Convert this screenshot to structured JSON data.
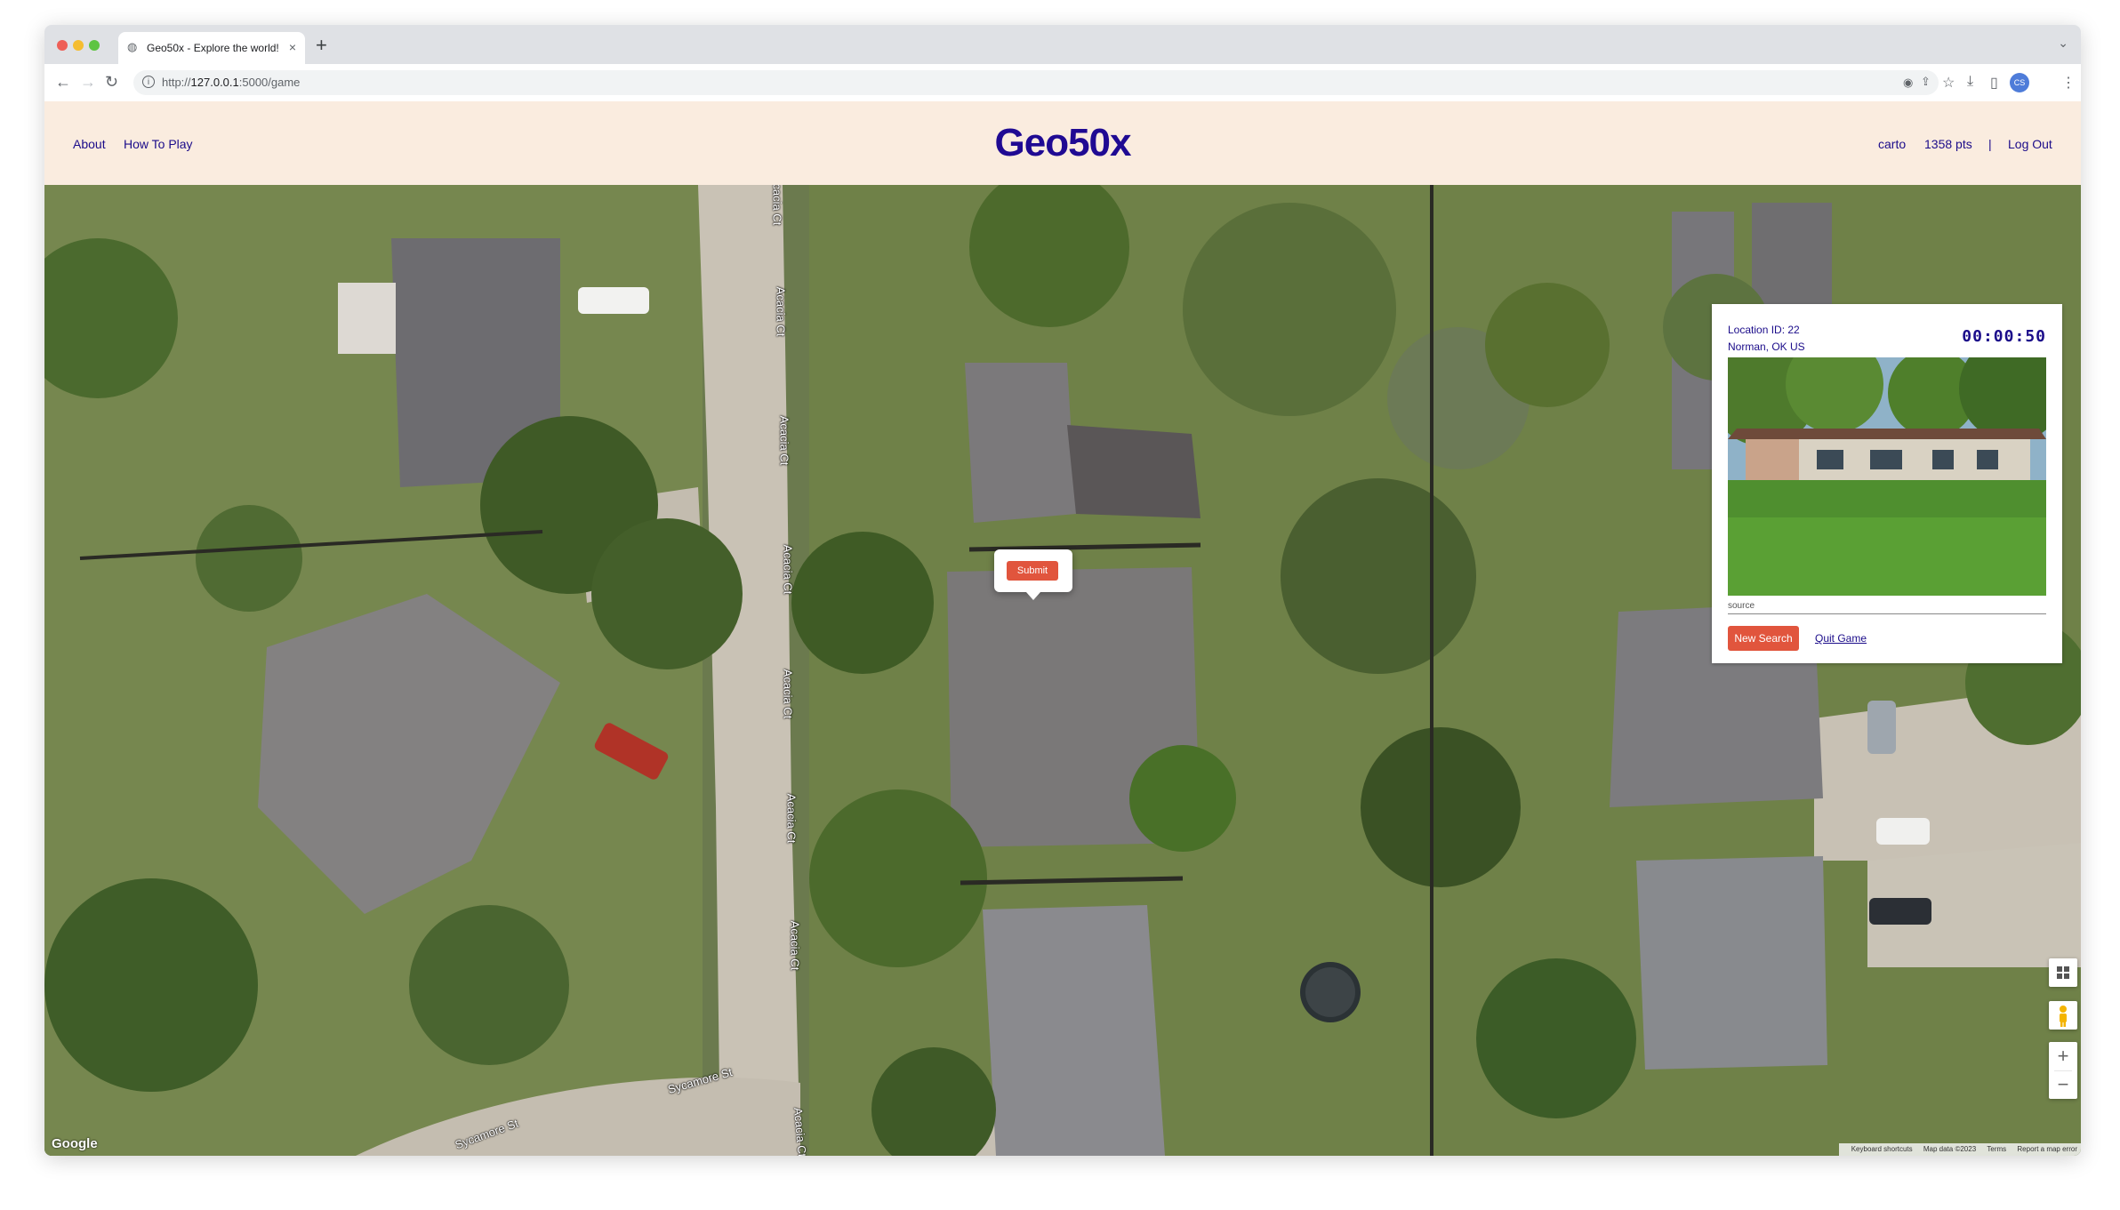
{
  "browser": {
    "tab_title": "Geo50x - Explore the world!",
    "tab_close": "×",
    "new_tab": "+",
    "tab_menu": "⌄",
    "url_prefix": "http://",
    "url_host": "127.0.0.1",
    "url_path": ":5000/game",
    "nav": {
      "back": "←",
      "forward": "→",
      "reload": "↻"
    },
    "toolbar_icons": [
      "eye-icon",
      "share-icon",
      "star-icon",
      "download-icon",
      "sidepanel-icon",
      "profile-avatar",
      "menu-icon"
    ],
    "traffic_colors": [
      "#ee5f57",
      "#f5bd30",
      "#5ec442"
    ]
  },
  "header": {
    "about": "About",
    "how_to_play": "How To Play",
    "brand": "Geo50x",
    "username": "carto",
    "points": "1358 pts",
    "separator": "|",
    "logout": "Log Out",
    "background": "#faecdf",
    "text_color": "#1b0c8a"
  },
  "panel": {
    "location_id": "Location ID: 22",
    "location_name": "Norman, OK US",
    "timer": "00:00:50",
    "source": "source",
    "new_search": "New Search",
    "quit_game": "Quit Game",
    "accent": "#e1553d"
  },
  "map": {
    "submit": "Submit",
    "streets": [
      "Acacia Ct",
      "Acacia Ct",
      "Acacia Ct",
      "Acacia Ct",
      "Acacia Ct",
      "Acacia Ct",
      "Acacia Ct",
      "Acacia Ct",
      "Sycamore St",
      "Sycamore St"
    ],
    "logo": "Google",
    "attribution": [
      "Keyboard shortcuts",
      "Map data ©2023",
      "Terms",
      "Report a map error"
    ],
    "zoom_in": "+",
    "zoom_out": "−"
  }
}
